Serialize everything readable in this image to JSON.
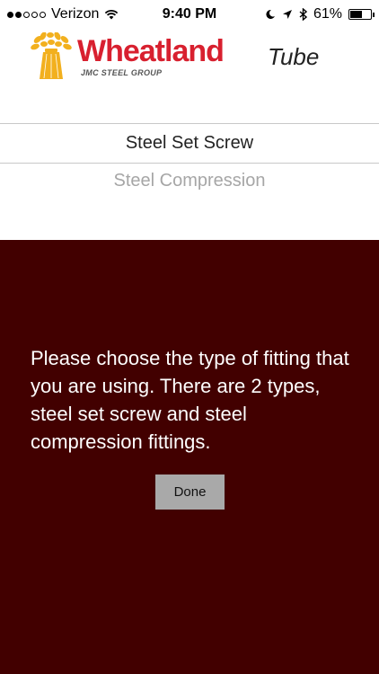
{
  "status_bar": {
    "carrier": "Verizon",
    "time": "9:40 PM",
    "battery": "61%",
    "battery_level": 0.61,
    "signal_bars_filled": 2,
    "signal_bars_total": 5,
    "icons": [
      "wifi-icon",
      "moon-icon",
      "location-arrow-icon",
      "bluetooth-icon",
      "battery-icon"
    ]
  },
  "logo": {
    "brand": "Wheatland",
    "product": "Tube",
    "tagline": "JMC STEEL GROUP",
    "brand_color": "#d8202f",
    "wheat_color": "#f2b01e"
  },
  "picker": {
    "options": [
      "Steel Set Screw",
      "Steel Compression"
    ],
    "selected": "Steel Set Screw"
  },
  "overlay": {
    "background": "#420000",
    "message": "Please choose the type of fitting that you are using.  There are 2 types, steel set screw and steel compression fittings.",
    "done_label": "Done"
  }
}
